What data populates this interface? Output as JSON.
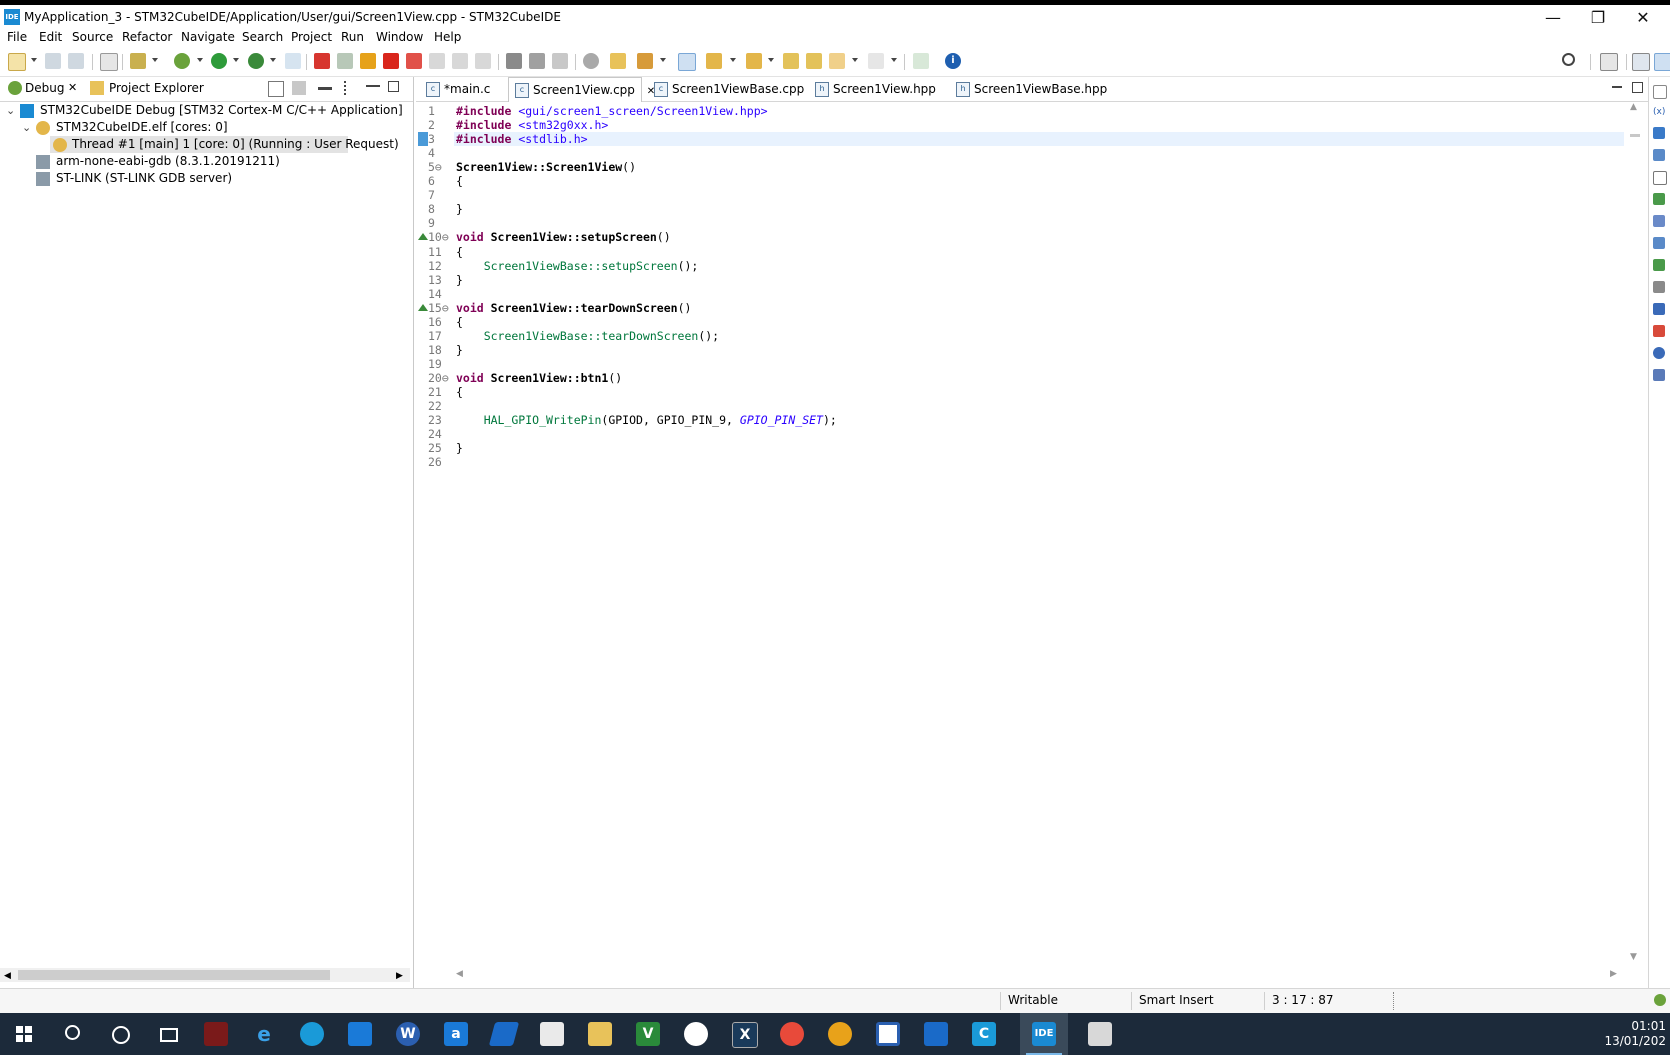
{
  "window": {
    "app_icon_text": "IDE",
    "title": "MyApplication_3 - STM32CubeIDE/Application/User/gui/Screen1View.cpp - STM32CubeIDE",
    "minimize": "—",
    "maximize": "❐",
    "close": "✕"
  },
  "menu": [
    "File",
    "Edit",
    "Source",
    "Refactor",
    "Navigate",
    "Search",
    "Project",
    "Run",
    "Window",
    "Help"
  ],
  "left_panel": {
    "tabs": [
      {
        "label": "Debug",
        "close": "✕"
      },
      {
        "label": "Project Explorer"
      }
    ],
    "tree": [
      {
        "label": "STM32CubeIDE Debug [STM32 Cortex-M C/C++ Application]",
        "twisty": "⌄",
        "icon": "ide"
      },
      {
        "label": "STM32CubeIDE.elf [cores: 0]",
        "twisty": "⌄",
        "icon": "process"
      },
      {
        "label": "Thread #1 [main] 1 [core: 0] (Running : User Request)",
        "icon": "thread"
      },
      {
        "label": "arm-none-eabi-gdb (8.3.1.20191211)",
        "icon": "debugger"
      },
      {
        "label": "ST-LINK (ST-LINK GDB server)",
        "icon": "debugger"
      }
    ]
  },
  "editor": {
    "tabs": [
      {
        "label": "*main.c",
        "icon_text": "c"
      },
      {
        "label": "Screen1View.cpp",
        "icon_text": "c",
        "close": "✕",
        "active": true
      },
      {
        "label": "Screen1ViewBase.cpp",
        "icon_text": "c"
      },
      {
        "label": "Screen1View.hpp",
        "icon_text": "h"
      },
      {
        "label": "Screen1ViewBase.hpp",
        "icon_text": "h"
      }
    ],
    "lines": [
      {
        "n": "1",
        "parts": [
          {
            "t": "#include ",
            "c": "kw"
          },
          {
            "t": "<gui/screen1_screen/Screen1View.hpp>",
            "c": "str"
          }
        ]
      },
      {
        "n": "2",
        "parts": [
          {
            "t": "#include ",
            "c": "kw"
          },
          {
            "t": "<stm32g0xx.h>",
            "c": "str"
          }
        ]
      },
      {
        "n": "3",
        "parts": [
          {
            "t": "#include ",
            "c": "kw"
          },
          {
            "t": "<stdlib.h>",
            "c": "str"
          }
        ],
        "highlight": true
      },
      {
        "n": "4",
        "parts": []
      },
      {
        "n": "5⊖",
        "parts": [
          {
            "t": "Screen1View::Screen1View",
            "c": "fn"
          },
          {
            "t": "()",
            "c": ""
          }
        ]
      },
      {
        "n": "6",
        "parts": [
          {
            "t": "{",
            "c": ""
          }
        ]
      },
      {
        "n": "7",
        "parts": []
      },
      {
        "n": "8",
        "parts": [
          {
            "t": "}",
            "c": ""
          }
        ]
      },
      {
        "n": "9",
        "parts": []
      },
      {
        "n": "10⊖",
        "parts": [
          {
            "t": "void ",
            "c": "kw"
          },
          {
            "t": "Screen1View::setupScreen",
            "c": "fn"
          },
          {
            "t": "()",
            "c": ""
          }
        ],
        "marker": true
      },
      {
        "n": "11",
        "parts": [
          {
            "t": "{",
            "c": ""
          }
        ]
      },
      {
        "n": "12",
        "parts": [
          {
            "t": "    Screen1ViewBase::setupScreen",
            "c": "call"
          },
          {
            "t": "();",
            "c": ""
          }
        ]
      },
      {
        "n": "13",
        "parts": [
          {
            "t": "}",
            "c": ""
          }
        ]
      },
      {
        "n": "14",
        "parts": []
      },
      {
        "n": "15⊖",
        "parts": [
          {
            "t": "void ",
            "c": "kw"
          },
          {
            "t": "Screen1View::tearDownScreen",
            "c": "fn"
          },
          {
            "t": "()",
            "c": ""
          }
        ],
        "marker": true
      },
      {
        "n": "16",
        "parts": [
          {
            "t": "{",
            "c": ""
          }
        ]
      },
      {
        "n": "17",
        "parts": [
          {
            "t": "    Screen1ViewBase::tearDownScreen",
            "c": "call"
          },
          {
            "t": "();",
            "c": ""
          }
        ]
      },
      {
        "n": "18",
        "parts": [
          {
            "t": "}",
            "c": ""
          }
        ]
      },
      {
        "n": "19",
        "parts": []
      },
      {
        "n": "20⊖",
        "parts": [
          {
            "t": "void ",
            "c": "kw"
          },
          {
            "t": "Screen1View::btn1",
            "c": "fn"
          },
          {
            "t": "()",
            "c": ""
          }
        ]
      },
      {
        "n": "21",
        "parts": [
          {
            "t": "{",
            "c": ""
          }
        ]
      },
      {
        "n": "22",
        "parts": []
      },
      {
        "n": "23",
        "parts": [
          {
            "t": "    HAL_GPIO_WritePin",
            "c": "call"
          },
          {
            "t": "(GPIOD, GPIO_PIN_9, ",
            "c": ""
          },
          {
            "t": "GPIO_PIN_SET",
            "c": "macro"
          },
          {
            "t": ");",
            "c": ""
          }
        ]
      },
      {
        "n": "24",
        "parts": []
      },
      {
        "n": "25",
        "parts": [
          {
            "t": "}",
            "c": ""
          }
        ]
      },
      {
        "n": "26",
        "parts": []
      }
    ]
  },
  "status": {
    "writable": "Writable",
    "insert_mode": "Smart Insert",
    "position": "3 : 17 : 87"
  },
  "taskbar": {
    "time": "01:01",
    "date": "13/01/202"
  },
  "colors": {
    "keyword": "#7f0055",
    "string": "#2a00ff",
    "call": "#00773c",
    "taskbar_bg": "#1c2a3a",
    "accent": "#1a8ad2"
  }
}
